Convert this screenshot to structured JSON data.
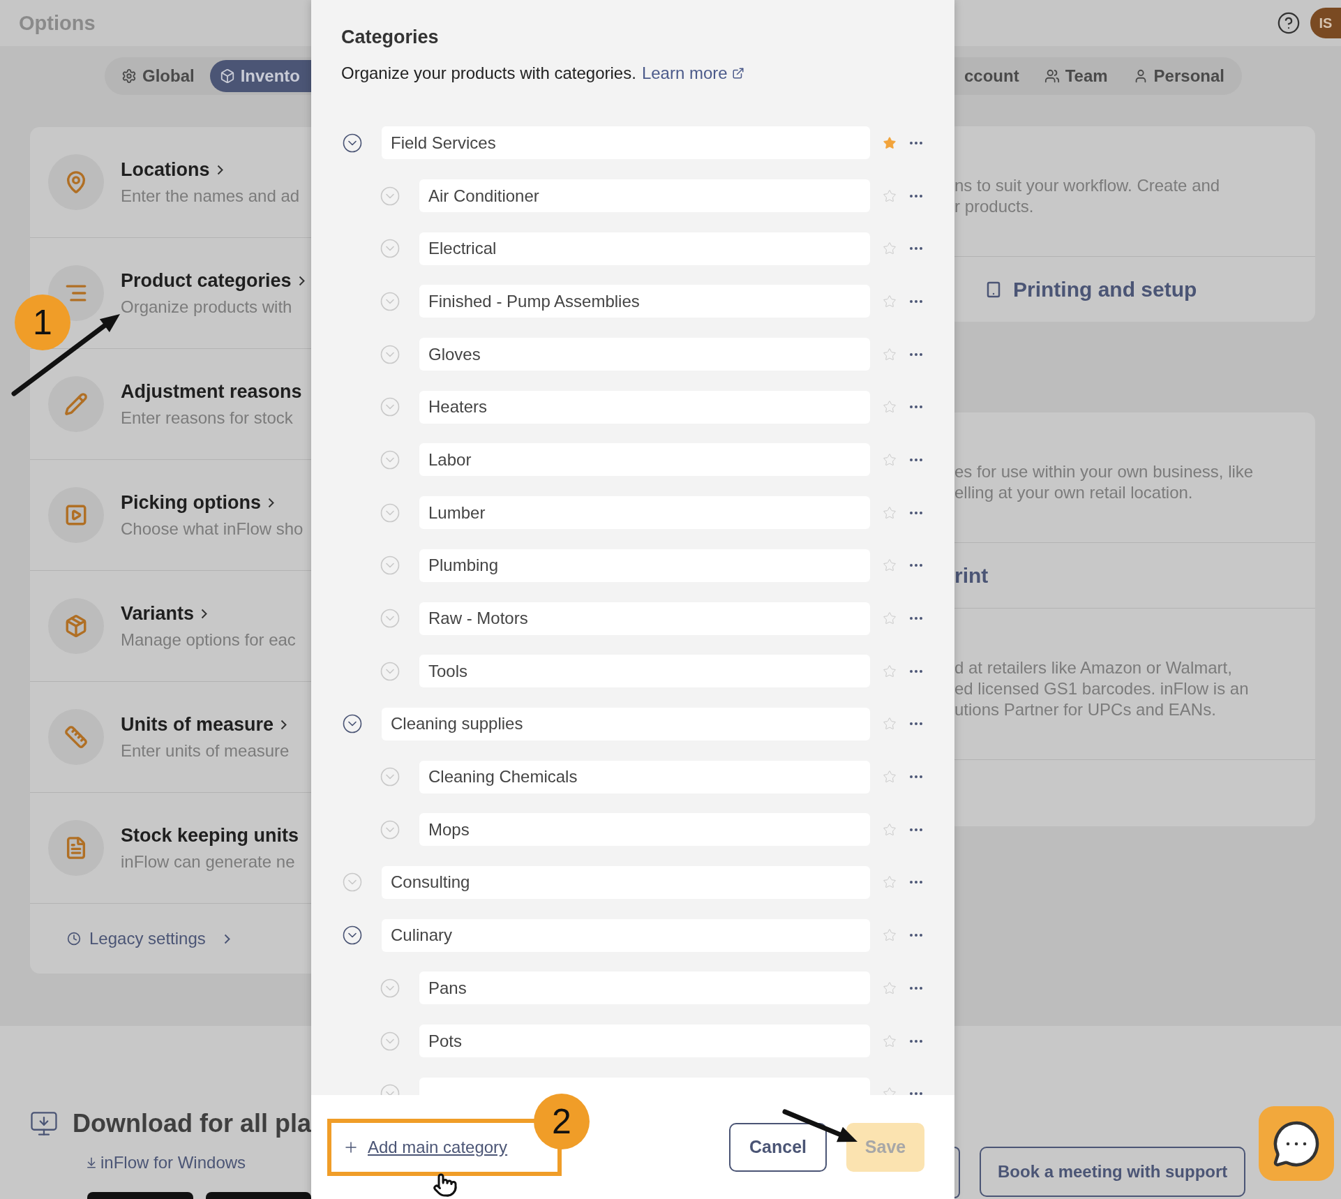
{
  "top_bar": {
    "title": "Options",
    "avatar": "IS"
  },
  "tabs": [
    {
      "label": "Global",
      "selected": false
    },
    {
      "label": "Invento",
      "selected": true
    },
    {
      "label": "ccount",
      "selected": false
    },
    {
      "label": "Team",
      "selected": false
    },
    {
      "label": "Personal",
      "selected": false
    }
  ],
  "settings_list": {
    "items": [
      {
        "title": "Locations",
        "description": "Enter the names and ad",
        "chevron": true
      },
      {
        "title": "Product categories",
        "description": "Organize products with",
        "chevron": true
      },
      {
        "title": "Adjustment reasons",
        "description": "Enter reasons for stock",
        "chevron": false
      },
      {
        "title": "Picking options",
        "description": "Choose what inFlow sho",
        "chevron": true
      },
      {
        "title": "Variants",
        "description": "Manage options for eac",
        "chevron": true
      },
      {
        "title": "Units of measure",
        "description": "Enter units of measure",
        "chevron": true
      },
      {
        "title": "Stock keeping units",
        "description": "inFlow can generate ne",
        "chevron": false
      }
    ],
    "legacy_link": "Legacy settings"
  },
  "right_cards": [
    {
      "sections": [
        {
          "kind": "text",
          "lines": [
            "ns to suit your workflow. Create and",
            "r products."
          ]
        },
        {
          "kind": "link",
          "label": "Printing and setup"
        }
      ]
    },
    {
      "sections": [
        {
          "kind": "text",
          "lines": [
            "es for use within your own business, like",
            "elling at your own retail location."
          ]
        },
        {
          "kind": "heading",
          "label": "rint"
        },
        {
          "kind": "text",
          "lines": [
            "d at retailers like Amazon or Walmart,",
            "ed licensed GS1 barcodes. inFlow is an",
            "utions Partner for UPCs and EANs."
          ]
        }
      ]
    }
  ],
  "modal": {
    "title": "Categories",
    "description": "Organize your products with categories.",
    "link": "Learn more",
    "categories": [
      {
        "name": "Field Services",
        "expanded": true,
        "starred": true,
        "children": [
          {
            "name": "Air Conditioner",
            "expanded": false,
            "starred": false
          },
          {
            "name": "Electrical",
            "expanded": false,
            "starred": false
          },
          {
            "name": "Finished - Pump Assemblies",
            "expanded": false,
            "starred": false
          },
          {
            "name": "Gloves",
            "expanded": false,
            "starred": false
          },
          {
            "name": "Heaters",
            "expanded": false,
            "starred": false
          },
          {
            "name": "Labor",
            "expanded": false,
            "starred": false
          },
          {
            "name": "Lumber",
            "expanded": false,
            "starred": false
          },
          {
            "name": "Plumbing",
            "expanded": false,
            "starred": false
          },
          {
            "name": "Raw - Motors",
            "expanded": false,
            "starred": false
          },
          {
            "name": "Tools",
            "expanded": false,
            "starred": false
          }
        ]
      },
      {
        "name": "Cleaning supplies",
        "expanded": true,
        "starred": false,
        "children": [
          {
            "name": "Cleaning Chemicals",
            "expanded": false,
            "starred": false
          },
          {
            "name": "Mops",
            "expanded": false,
            "starred": false
          }
        ]
      },
      {
        "name": "Consulting",
        "expanded": false,
        "starred": false
      },
      {
        "name": "Culinary",
        "expanded": true,
        "starred": false,
        "children": [
          {
            "name": "Pans",
            "expanded": false,
            "starred": false
          },
          {
            "name": "Pots",
            "expanded": false,
            "starred": false
          },
          {
            "expanded": false,
            "starred": false
          }
        ]
      }
    ],
    "add_button": "Add main category",
    "cancel": "Cancel",
    "save": {
      "label": "Save",
      "disabled": true
    }
  },
  "download": {
    "title": "Download for all pla",
    "link": "inFlow for Windows"
  },
  "support_button": "Book a meeting with support",
  "annotations": [
    "1",
    "2"
  ]
}
